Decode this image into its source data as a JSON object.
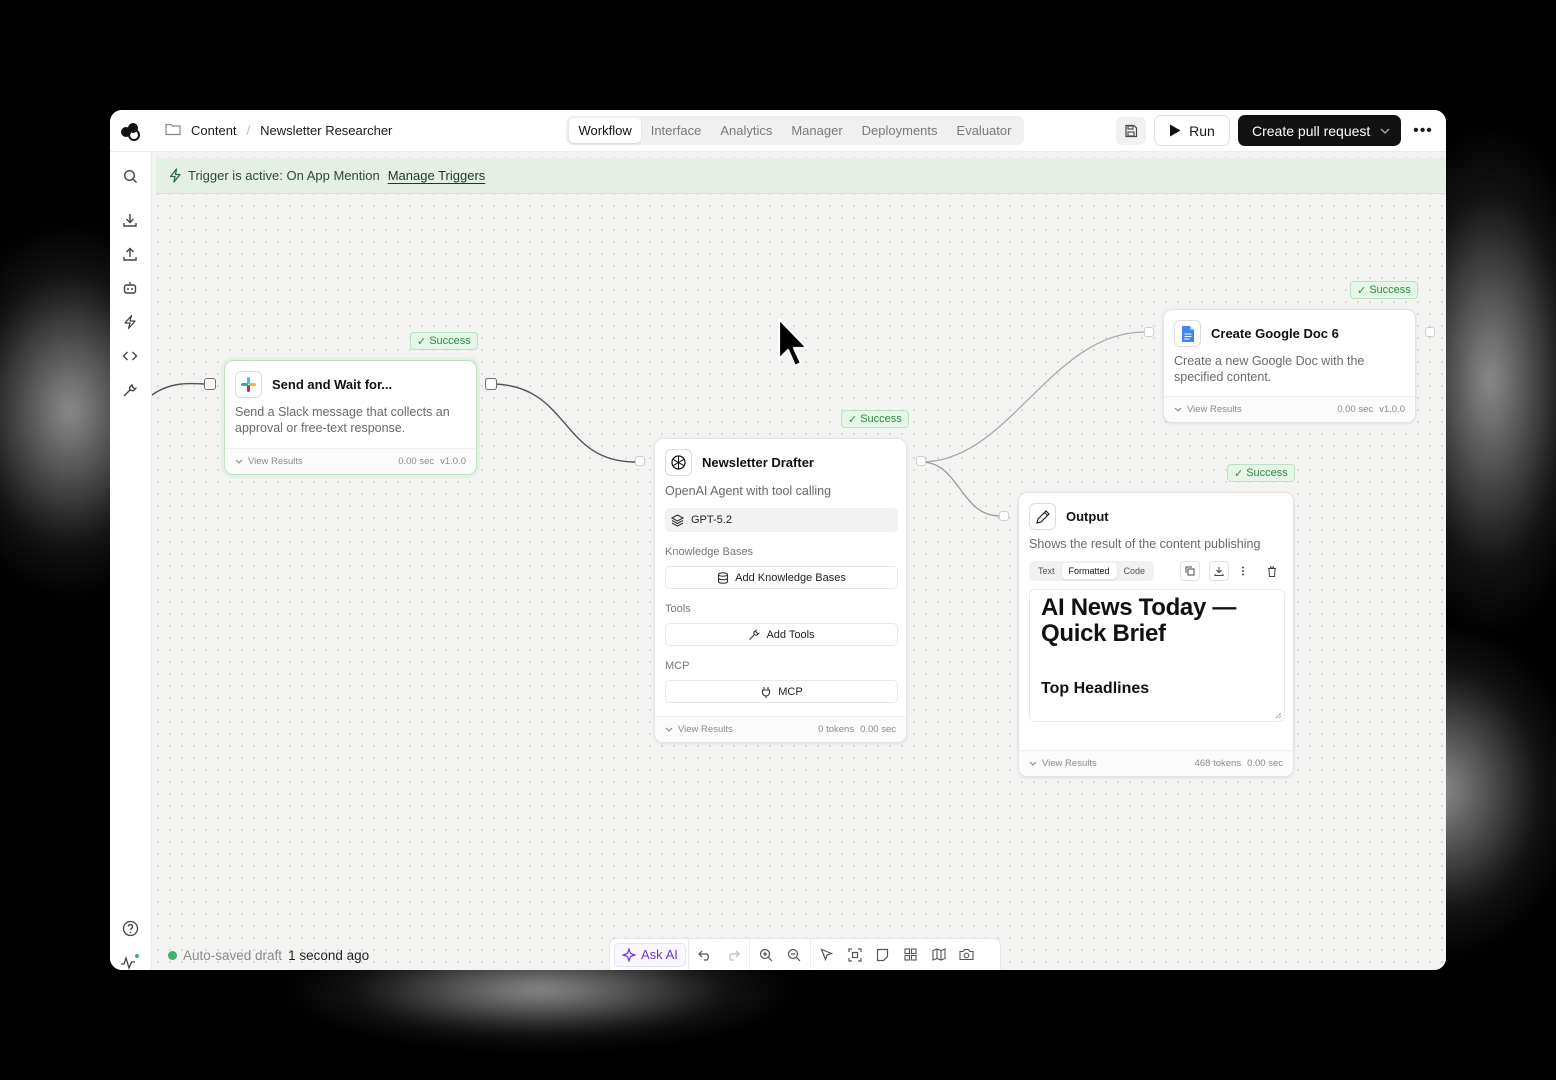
{
  "breadcrumb": {
    "folder": "Content",
    "workflow": "Newsletter Researcher"
  },
  "tabs": [
    {
      "label": "Workflow",
      "active": true
    },
    {
      "label": "Interface",
      "active": false
    },
    {
      "label": "Analytics",
      "active": false
    },
    {
      "label": "Manager",
      "active": false
    },
    {
      "label": "Deployments",
      "active": false
    },
    {
      "label": "Evaluator",
      "active": false
    }
  ],
  "toolbar": {
    "run_label": "Run",
    "pr_label": "Create pull request"
  },
  "trigger": {
    "text": "Trigger is active: On App Mention",
    "manage_label": "Manage Triggers"
  },
  "nodes": {
    "slack": {
      "badge": "Success",
      "title": "Send and Wait for...",
      "desc": "Send a Slack message that collects an approval or free-text response.",
      "view": "View Results",
      "time": "0.00 sec",
      "version": "v1.0.0"
    },
    "drafter": {
      "badge": "Success",
      "title": "Newsletter Drafter",
      "desc": "OpenAI Agent with tool calling",
      "model": "GPT-5.2",
      "kb_label": "Knowledge Bases",
      "kb_button": "Add Knowledge Bases",
      "tools_label": "Tools",
      "tools_button": "Add Tools",
      "mcp_label": "MCP",
      "mcp_button": "MCP",
      "view": "View Results",
      "tokens": "0 tokens",
      "time": "0.00 sec"
    },
    "gdoc": {
      "badge": "Success",
      "title": "Create Google Doc 6",
      "desc": "Create a new Google Doc with the specified content.",
      "view": "View Results",
      "time": "0.00 sec",
      "version": "v1.0.0"
    },
    "output": {
      "badge": "Success",
      "title": "Output",
      "desc": "Shows the result of the content publishing",
      "tabs": [
        "Text",
        "Formatted",
        "Code"
      ],
      "heading": "AI News Today — Quick Brief",
      "subheading": "Top Headlines",
      "view": "View Results",
      "tokens": "468 tokens",
      "time": "0.00 sec"
    }
  },
  "status": {
    "prefix": "Auto-saved draft",
    "time": "1 second ago"
  },
  "ask_ai": "Ask AI",
  "colors": {
    "success": "#2f8a45",
    "accent_purple": "#6b38c9",
    "primary_dark": "#121212"
  }
}
